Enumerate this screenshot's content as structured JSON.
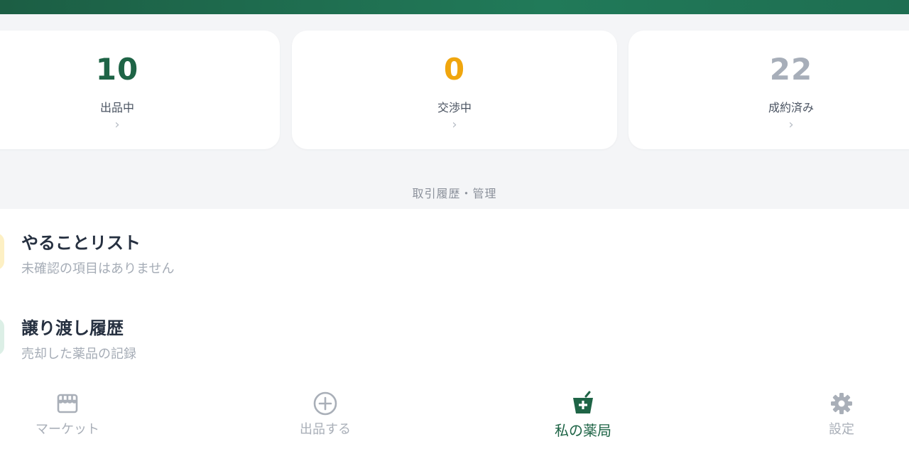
{
  "stats": [
    {
      "value": "10",
      "label": "出品中",
      "color": "#1e6446"
    },
    {
      "value": "0",
      "label": "交渉中",
      "color": "#f0a60e"
    },
    {
      "value": "22",
      "label": "成約済み",
      "color": "#a7aeb9"
    }
  ],
  "chevron": "›",
  "section": {
    "title": "取引履歴・管理"
  },
  "list": [
    {
      "title": "やることリスト",
      "subtitle": "未確認の項目はありません"
    },
    {
      "title": "譲り渡し履歴",
      "subtitle": "売却した薬品の記録"
    }
  ],
  "nav": {
    "market": {
      "label": "マーケット",
      "icon": "store-icon"
    },
    "sell": {
      "label": "出品する",
      "icon": "plus-circle-icon"
    },
    "pharmacy": {
      "label": "私の薬局",
      "icon": "pharmacy-icon"
    },
    "settings": {
      "label": "設定",
      "icon": "gear-icon"
    }
  },
  "colors": {
    "brand": "#1e6446",
    "accent": "#f0a60e",
    "muted": "#a7aeb9"
  }
}
